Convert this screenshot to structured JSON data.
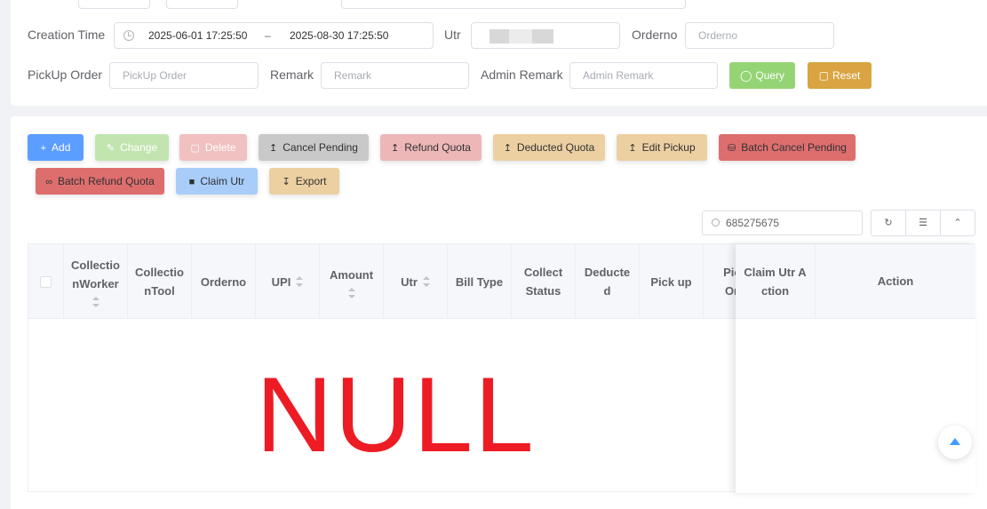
{
  "search": {
    "creation_time_label": "Creation Time",
    "date_start": "2025-06-01 17:25:50",
    "date_sep": "–",
    "date_end": "2025-08-30 17:25:50",
    "utr_label": "Utr",
    "orderno_label": "Orderno",
    "orderno_placeholder": "Orderno",
    "pickup_label": "PickUp Order",
    "pickup_placeholder": "PickUp Order",
    "remark_label": "Remark",
    "remark_placeholder": "Remark",
    "admin_remark_label": "Admin Remark",
    "admin_remark_placeholder": "Admin Remark",
    "query_label": "Query",
    "reset_label": "Reset"
  },
  "toolbar": {
    "add": "Add",
    "change": "Change",
    "delete": "Delete",
    "cancel_pending": "Cancel Pending",
    "refund_quota": "Refund Quota",
    "deducted_quota": "Deducted Quota",
    "edit_pickup": "Edit Pickup",
    "batch_cancel_pending": "Batch Cancel Pending",
    "batch_refund_quota": "Batch Refund Quota",
    "claim_utr": "Claim Utr",
    "export": "Export"
  },
  "table_search": {
    "value": "685275675"
  },
  "table": {
    "columns": [
      "CollectionWorker",
      "CollectionTool",
      "Orderno",
      "UPI",
      "Amount",
      "Utr",
      "Bill Type",
      "Collect Status",
      "Deducted",
      "Pick up",
      "Pick Ord",
      "Claim Utr Action",
      "Action"
    ],
    "empty_text": "NULL"
  },
  "colors": {
    "primary": "#409eff",
    "success": "#95d475",
    "warning": "#e6a23c",
    "danger": "#e07070",
    "null_text": "#ed1c24"
  }
}
